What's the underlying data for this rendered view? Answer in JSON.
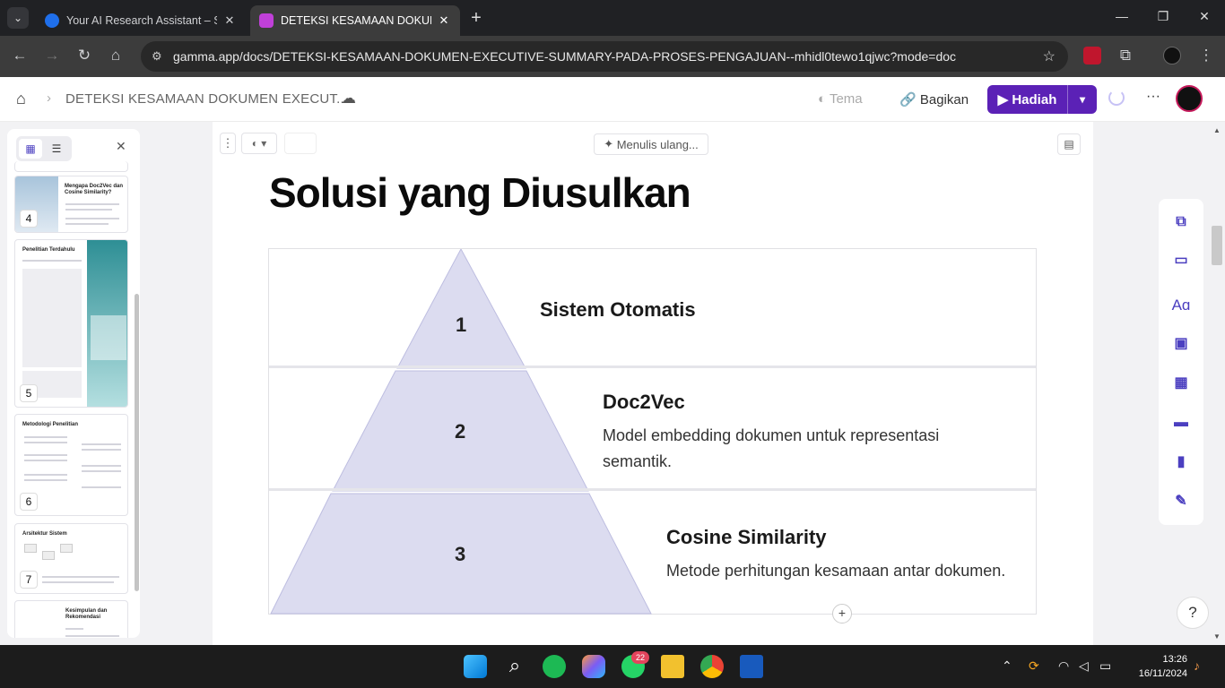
{
  "browser": {
    "tabs": [
      {
        "title": "Your AI Research Assistant – Sci",
        "active": false
      },
      {
        "title": "DETEKSI KESAMAAN DOKUMEN",
        "active": true
      }
    ],
    "url": "gamma.app/docs/DETEKSI-KESAMAAN-DOKUMEN-EXECUTIVE-SUMMARY-PADA-PROSES-PENGAJUAN--mhidl0tewo1qjwc?mode=doc"
  },
  "header": {
    "breadcrumb": "DETEKSI KESAMAAN DOKUMEN EXECUT...",
    "theme_label": "Tema",
    "share_label": "Bagikan",
    "present_label": "Hadiah"
  },
  "sidebar": {
    "slides": [
      {
        "number": "4",
        "title": "Mengapa Doc2Vec dan Cosine Similarity?"
      },
      {
        "number": "5",
        "title": "Penelitian Terdahulu"
      },
      {
        "number": "6",
        "title": "Metodologi Penelitian"
      },
      {
        "number": "7",
        "title": "Arsitektur Sistem"
      },
      {
        "number": "",
        "title": "Kesimpulan dan Rekomendasi"
      }
    ]
  },
  "canvas": {
    "rewrite_label": "Menulis ulang...",
    "heading": "Solusi yang Diusulkan",
    "pyramid_color": "#dcdcf0",
    "levels": [
      {
        "number": "1",
        "title": "Sistem Otomatis",
        "desc": ""
      },
      {
        "number": "2",
        "title": "Doc2Vec",
        "desc": "Model embedding dokumen untuk representasi semantik."
      },
      {
        "number": "3",
        "title": "Cosine Similarity",
        "desc": "Metode perhitungan kesamaan antar dokumen."
      }
    ]
  },
  "accent_color": "#5b21b6",
  "taskbar": {
    "whatsapp_badge": "22",
    "time": "13:26",
    "date": "16/11/2024"
  }
}
